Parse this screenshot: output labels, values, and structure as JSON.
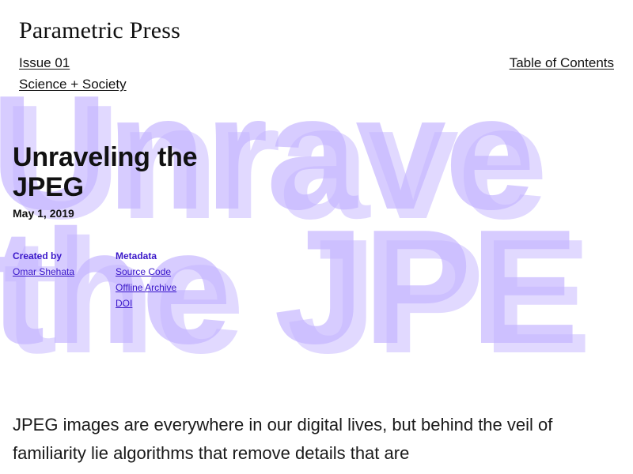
{
  "header": {
    "masthead": "Parametric Press",
    "issue_link": "Issue 01",
    "section_link": "Science + Society",
    "toc_link": "Table of Contents"
  },
  "background_title": {
    "line1": "Unrave",
    "line2": "the JPE"
  },
  "article": {
    "title": "Unraveling the JPEG",
    "date": "May 1, 2019",
    "created_by": {
      "heading": "Created by",
      "author": "Omar Shehata"
    },
    "metadata": {
      "heading": "Metadata",
      "links": [
        "Source Code",
        "Offline Archive",
        "DOI"
      ]
    },
    "intro": "JPEG images are everywhere in our digital lives, but behind the veil of familiarity lie algorithms that remove details that are"
  },
  "colors": {
    "accent": "#3a17c9",
    "background_title": "#c4b4ff",
    "text": "#111111"
  }
}
